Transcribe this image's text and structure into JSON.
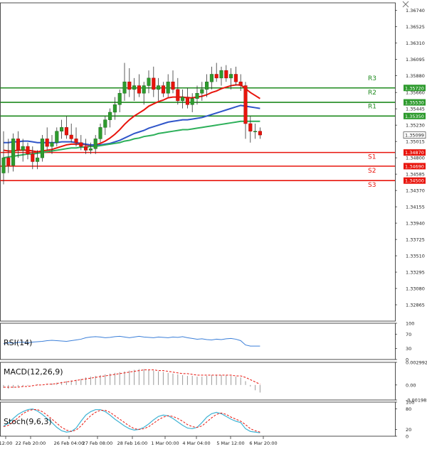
{
  "chart_data": [
    {
      "type": "candlestick",
      "ylim": [
        1.3265,
        1.3684
      ],
      "yticks": [
        "1.36740",
        "1.36525",
        "1.36310",
        "1.36095",
        "1.35880",
        "1.35660",
        "1.35445",
        "1.35230",
        "1.35015",
        "1.34800",
        "1.34585",
        "1.34370",
        "1.34155",
        "1.33940",
        "1.33725",
        "1.33510",
        "1.33295",
        "1.33080",
        "1.32865"
      ],
      "xticks": [
        "12:00",
        "22 Feb 20:00",
        "26 Feb 04:00",
        "27 Feb 08:00",
        "28 Feb 16:00",
        "1 Mar 00:00",
        "4 Mar 04:00",
        "5 Mar 12:00",
        "6 Mar 20:00"
      ],
      "current_price": "1.35099",
      "candles": [
        [
          1.346,
          1.3515,
          1.3445,
          1.348
        ],
        [
          1.348,
          1.3505,
          1.346,
          1.347
        ],
        [
          1.347,
          1.3512,
          1.3462,
          1.3505
        ],
        [
          1.3505,
          1.3515,
          1.348,
          1.349
        ],
        [
          1.349,
          1.3505,
          1.3475,
          1.3495
        ],
        [
          1.3495,
          1.35,
          1.3478,
          1.3485
        ],
        [
          1.3485,
          1.3495,
          1.3465,
          1.3475
        ],
        [
          1.3475,
          1.349,
          1.3465,
          1.348
        ],
        [
          1.348,
          1.351,
          1.3475,
          1.3505
        ],
        [
          1.3505,
          1.352,
          1.349,
          1.3495
        ],
        [
          1.3495,
          1.351,
          1.3485,
          1.35
        ],
        [
          1.35,
          1.352,
          1.3495,
          1.3515
        ],
        [
          1.3515,
          1.353,
          1.3505,
          1.352
        ],
        [
          1.352,
          1.3535,
          1.3505,
          1.351
        ],
        [
          1.351,
          1.3525,
          1.35,
          1.3505
        ],
        [
          1.3505,
          1.352,
          1.3495,
          1.35
        ],
        [
          1.35,
          1.351,
          1.349,
          1.3495
        ],
        [
          1.3495,
          1.3505,
          1.3485,
          1.349
        ],
        [
          1.349,
          1.35,
          1.3485,
          1.3492
        ],
        [
          1.3492,
          1.351,
          1.3485,
          1.3505
        ],
        [
          1.3505,
          1.3525,
          1.35,
          1.352
        ],
        [
          1.352,
          1.3535,
          1.351,
          1.353
        ],
        [
          1.353,
          1.3545,
          1.352,
          1.354
        ],
        [
          1.354,
          1.356,
          1.353,
          1.355
        ],
        [
          1.355,
          1.357,
          1.354,
          1.3565
        ],
        [
          1.3565,
          1.3605,
          1.3555,
          1.358
        ],
        [
          1.358,
          1.3598,
          1.356,
          1.357
        ],
        [
          1.357,
          1.3585,
          1.3555,
          1.3575
        ],
        [
          1.3575,
          1.359,
          1.356,
          1.3565
        ],
        [
          1.3565,
          1.358,
          1.355,
          1.3575
        ],
        [
          1.3575,
          1.3595,
          1.3565,
          1.3585
        ],
        [
          1.3585,
          1.36,
          1.356,
          1.357
        ],
        [
          1.357,
          1.3585,
          1.3555,
          1.3575
        ],
        [
          1.3575,
          1.358,
          1.356,
          1.3565
        ],
        [
          1.3565,
          1.359,
          1.356,
          1.358
        ],
        [
          1.358,
          1.3595,
          1.3565,
          1.357
        ],
        [
          1.357,
          1.3585,
          1.355,
          1.3555
        ],
        [
          1.3555,
          1.357,
          1.3545,
          1.356
        ],
        [
          1.356,
          1.3572,
          1.3545,
          1.355
        ],
        [
          1.355,
          1.3565,
          1.354,
          1.3558
        ],
        [
          1.3558,
          1.3575,
          1.355,
          1.3565
        ],
        [
          1.3565,
          1.358,
          1.3555,
          1.357
        ],
        [
          1.357,
          1.359,
          1.356,
          1.358
        ],
        [
          1.358,
          1.36,
          1.357,
          1.359
        ],
        [
          1.359,
          1.3605,
          1.358,
          1.3585
        ],
        [
          1.3585,
          1.36,
          1.3575,
          1.3595
        ],
        [
          1.3595,
          1.3602,
          1.358,
          1.3585
        ],
        [
          1.3585,
          1.3598,
          1.357,
          1.359
        ],
        [
          1.359,
          1.36,
          1.3575,
          1.358
        ],
        [
          1.358,
          1.359,
          1.3568,
          1.3575
        ],
        [
          1.3575,
          1.358,
          1.3505,
          1.3525
        ],
        [
          1.3525,
          1.3535,
          1.35,
          1.3515
        ],
        [
          1.3515,
          1.3525,
          1.3505,
          1.3515
        ],
        [
          1.3515,
          1.352,
          1.3505,
          1.351
        ]
      ],
      "series": [
        {
          "color": "#e8140c",
          "values": [
            1.349,
            1.3489,
            1.3489,
            1.349,
            1.349,
            1.349,
            1.3489,
            1.3488,
            1.3489,
            1.349,
            1.3491,
            1.3493,
            1.3495,
            1.3497,
            1.3498,
            1.3498,
            1.3498,
            1.3497,
            1.3496,
            1.3497,
            1.3499,
            1.3502,
            1.3506,
            1.3511,
            1.3517,
            1.3524,
            1.353,
            1.3535,
            1.3539,
            1.3543,
            1.3548,
            1.3551,
            1.3554,
            1.3556,
            1.3559,
            1.356,
            1.356,
            1.356,
            1.3559,
            1.3559,
            1.356,
            1.3561,
            1.3563,
            1.3566,
            1.3568,
            1.3571,
            1.3573,
            1.3575,
            1.3576,
            1.3576,
            1.3571,
            1.3566,
            1.3562,
            1.3558
          ]
        },
        {
          "color": "#2f55c9",
          "values": [
            1.35,
            1.35,
            1.3501,
            1.3501,
            1.3502,
            1.3502,
            1.3501,
            1.35,
            1.35,
            1.35,
            1.35,
            1.35,
            1.3501,
            1.3501,
            1.3501,
            1.35,
            1.3499,
            1.3498,
            1.3497,
            1.3497,
            1.3497,
            1.3498,
            1.3499,
            1.3501,
            1.3503,
            1.3506,
            1.3509,
            1.3512,
            1.3514,
            1.3516,
            1.3519,
            1.3521,
            1.3523,
            1.3525,
            1.3527,
            1.3528,
            1.3529,
            1.353,
            1.353,
            1.3531,
            1.3532,
            1.3533,
            1.3535,
            1.3537,
            1.3539,
            1.3541,
            1.3543,
            1.3545,
            1.3547,
            1.3549,
            1.3548,
            1.3547,
            1.3546,
            1.3545
          ]
        },
        {
          "color": "#2db05a",
          "values": [
            1.348,
            1.3481,
            1.3482,
            1.3483,
            1.3484,
            1.3485,
            1.3485,
            1.3486,
            1.3487,
            1.3488,
            1.3489,
            1.349,
            1.3491,
            1.3492,
            1.3493,
            1.3493,
            1.3494,
            1.3494,
            1.3495,
            1.3495,
            1.3496,
            1.3497,
            1.3498,
            1.3499,
            1.35,
            1.3502,
            1.3503,
            1.3505,
            1.3506,
            1.3508,
            1.3509,
            1.351,
            1.3512,
            1.3513,
            1.3514,
            1.3515,
            1.3516,
            1.3517,
            1.3517,
            1.3518,
            1.3519,
            1.352,
            1.3521,
            1.3522,
            1.3523,
            1.3524,
            1.3525,
            1.3526,
            1.3527,
            1.3528,
            1.3528,
            1.3528,
            1.3528,
            1.3528
          ]
        }
      ],
      "levels": [
        {
          "name": "R3",
          "value": 1.3572,
          "tag": "1.35720",
          "color": "#1e8a1e",
          "tagbg": "#2e9b2e"
        },
        {
          "name": "R2",
          "value": 1.3553,
          "tag": "1.35530",
          "color": "#1e8a1e",
          "tagbg": "#2e9b2e"
        },
        {
          "name": "R1",
          "value": 1.3535,
          "tag": "1.35350",
          "color": "#1e8a1e",
          "tagbg": "#2e9b2e"
        },
        {
          "name": "S1",
          "value": 1.3487,
          "tag": "1.34870",
          "color": "#e8140c",
          "tagbg": "#e8140c"
        },
        {
          "name": "S2",
          "value": 1.3469,
          "tag": "1.34690",
          "color": "#e8140c",
          "tagbg": "#e8140c"
        },
        {
          "name": "S3",
          "value": 1.345,
          "tag": "1.34500",
          "color": "#e8140c",
          "tagbg": "#e8140c"
        }
      ]
    },
    {
      "type": "line",
      "title": "RSI(14)",
      "ylim": [
        0,
        100
      ],
      "yticks": [
        "100",
        "70",
        "30",
        "0"
      ],
      "color": "#3b7fd9",
      "values": [
        44,
        46,
        45,
        47,
        48,
        46,
        48,
        49,
        50,
        52,
        53,
        52,
        51,
        50,
        52,
        54,
        56,
        60,
        62,
        63,
        62,
        60,
        61,
        63,
        64,
        62,
        60,
        62,
        64,
        62,
        61,
        60,
        62,
        61,
        60,
        62,
        61,
        63,
        60,
        58,
        56,
        57,
        55,
        54,
        56,
        55,
        57,
        58,
        56,
        52,
        40,
        37,
        37,
        37
      ]
    },
    {
      "type": "histogram",
      "title": "MACD(12,26,9)",
      "ylim": [
        -0.001985,
        0.002992
      ],
      "yticks": [
        "0.002992",
        "0.00",
        "-0.001985"
      ],
      "bars": [
        -0.0004,
        -0.0005,
        -0.0004,
        -0.0003,
        -0.0002,
        -0.0001,
        0.0,
        0.0001,
        0.0,
        0.0001,
        0.0002,
        0.0003,
        0.0004,
        0.0005,
        0.0006,
        0.0007,
        0.0008,
        0.001,
        0.0011,
        0.0012,
        0.0013,
        0.0014,
        0.0015,
        0.0016,
        0.0017,
        0.0018,
        0.0019,
        0.002,
        0.0021,
        0.0021,
        0.002,
        0.0019,
        0.0018,
        0.0017,
        0.0016,
        0.0015,
        0.0014,
        0.0013,
        0.0012,
        0.0012,
        0.0011,
        0.0011,
        0.0012,
        0.0013,
        0.0013,
        0.0013,
        0.0013,
        0.0012,
        0.0011,
        0.001,
        0.0005,
        -0.0002,
        -0.0007,
        -0.001
      ],
      "signal": [
        -0.0003,
        -0.0003,
        -0.0003,
        -0.0003,
        -0.0002,
        -0.0002,
        -0.0001,
        0.0,
        0.0,
        0.0001,
        0.0001,
        0.0002,
        0.0003,
        0.0004,
        0.0005,
        0.0006,
        0.0007,
        0.0008,
        0.0009,
        0.001,
        0.0011,
        0.0012,
        0.0013,
        0.0014,
        0.0015,
        0.0016,
        0.0017,
        0.0018,
        0.0019,
        0.002,
        0.002,
        0.002,
        0.0019,
        0.0019,
        0.0018,
        0.0017,
        0.0016,
        0.0015,
        0.0015,
        0.0014,
        0.0013,
        0.0013,
        0.0013,
        0.0013,
        0.0013,
        0.0013,
        0.0013,
        0.0013,
        0.0012,
        0.0012,
        0.001,
        0.0007,
        0.0004,
        0.0001
      ],
      "signal_color": "#e8140c"
    },
    {
      "type": "line",
      "title": "Stoch(9,6,3)",
      "ylim": [
        0,
        100
      ],
      "yticks": [
        "100",
        "80",
        "20",
        "0"
      ],
      "k": [
        30,
        38,
        52,
        64,
        72,
        78,
        80,
        74,
        64,
        52,
        40,
        26,
        16,
        12,
        14,
        24,
        44,
        62,
        72,
        78,
        78,
        72,
        62,
        50,
        40,
        30,
        22,
        18,
        20,
        26,
        36,
        48,
        58,
        62,
        60,
        52,
        42,
        32,
        24,
        22,
        26,
        40,
        56,
        66,
        70,
        66,
        58,
        50,
        44,
        40,
        22,
        14,
        12,
        10
      ],
      "d": [
        28,
        32,
        42,
        54,
        66,
        74,
        78,
        78,
        72,
        62,
        50,
        38,
        26,
        18,
        14,
        18,
        30,
        46,
        60,
        70,
        76,
        76,
        70,
        60,
        50,
        40,
        30,
        22,
        20,
        22,
        28,
        38,
        48,
        56,
        60,
        58,
        52,
        44,
        34,
        28,
        26,
        30,
        42,
        54,
        64,
        68,
        64,
        56,
        50,
        44,
        34,
        22,
        16,
        12
      ],
      "k_color": "#3fb3d4",
      "d_color": "#e8140c"
    }
  ]
}
